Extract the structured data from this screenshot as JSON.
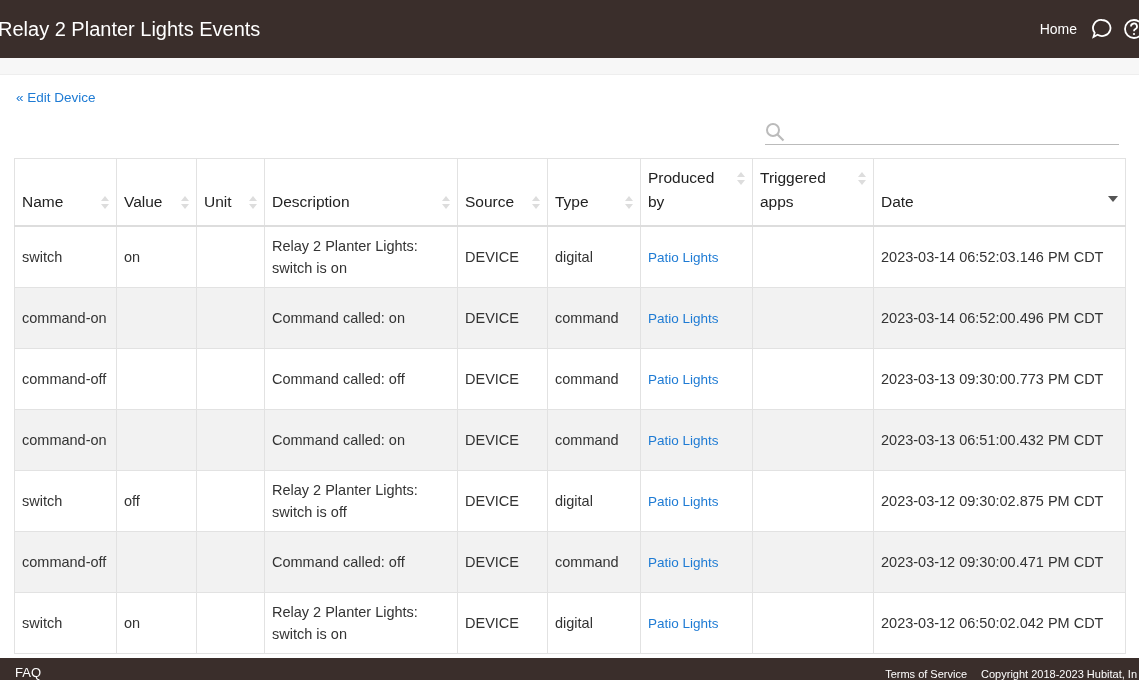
{
  "header": {
    "title": "Relay 2 Planter Lights Events",
    "home_link": "Home"
  },
  "back_link": "« Edit Device",
  "table": {
    "columns": [
      {
        "label": "Name",
        "sorted": false
      },
      {
        "label": "Value",
        "sorted": false
      },
      {
        "label": "Unit",
        "sorted": false
      },
      {
        "label": "Description",
        "sorted": false
      },
      {
        "label": "Source",
        "sorted": false
      },
      {
        "label": "Type",
        "sorted": false
      },
      {
        "label": "Produced by",
        "sorted": false
      },
      {
        "label": "Triggered apps",
        "sorted": false
      },
      {
        "label": "Date",
        "sorted": true
      }
    ],
    "rows": [
      {
        "name": "switch",
        "value": "on",
        "unit": "",
        "description": "Relay 2 Planter Lights: switch is on",
        "source": "DEVICE",
        "type": "digital",
        "produced_by": "Patio Lights",
        "triggered_apps": "",
        "date": "2023-03-14 06:52:03.146 PM CDT"
      },
      {
        "name": "command-on",
        "value": "",
        "unit": "",
        "description": "Command called: on",
        "source": "DEVICE",
        "type": "command",
        "produced_by": "Patio Lights",
        "triggered_apps": "",
        "date": "2023-03-14 06:52:00.496 PM CDT"
      },
      {
        "name": "command-off",
        "value": "",
        "unit": "",
        "description": "Command called: off",
        "source": "DEVICE",
        "type": "command",
        "produced_by": "Patio Lights",
        "triggered_apps": "",
        "date": "2023-03-13 09:30:00.773 PM CDT"
      },
      {
        "name": "command-on",
        "value": "",
        "unit": "",
        "description": "Command called: on",
        "source": "DEVICE",
        "type": "command",
        "produced_by": "Patio Lights",
        "triggered_apps": "",
        "date": "2023-03-13 06:51:00.432 PM CDT"
      },
      {
        "name": "switch",
        "value": "off",
        "unit": "",
        "description": "Relay 2 Planter Lights: switch is off",
        "source": "DEVICE",
        "type": "digital",
        "produced_by": "Patio Lights",
        "triggered_apps": "",
        "date": "2023-03-12 09:30:02.875 PM CDT"
      },
      {
        "name": "command-off",
        "value": "",
        "unit": "",
        "description": "Command called: off",
        "source": "DEVICE",
        "type": "command",
        "produced_by": "Patio Lights",
        "triggered_apps": "",
        "date": "2023-03-12 09:30:00.471 PM CDT"
      },
      {
        "name": "switch",
        "value": "on",
        "unit": "",
        "description": "Relay 2 Planter Lights: switch is on",
        "source": "DEVICE",
        "type": "digital",
        "produced_by": "Patio Lights",
        "triggered_apps": "",
        "date": "2023-03-12 06:50:02.042 PM CDT"
      }
    ]
  },
  "footer": {
    "faq": "FAQ",
    "terms": "Terms of Service",
    "copyright": "Copyright 2018-2023 Hubitat, In"
  }
}
